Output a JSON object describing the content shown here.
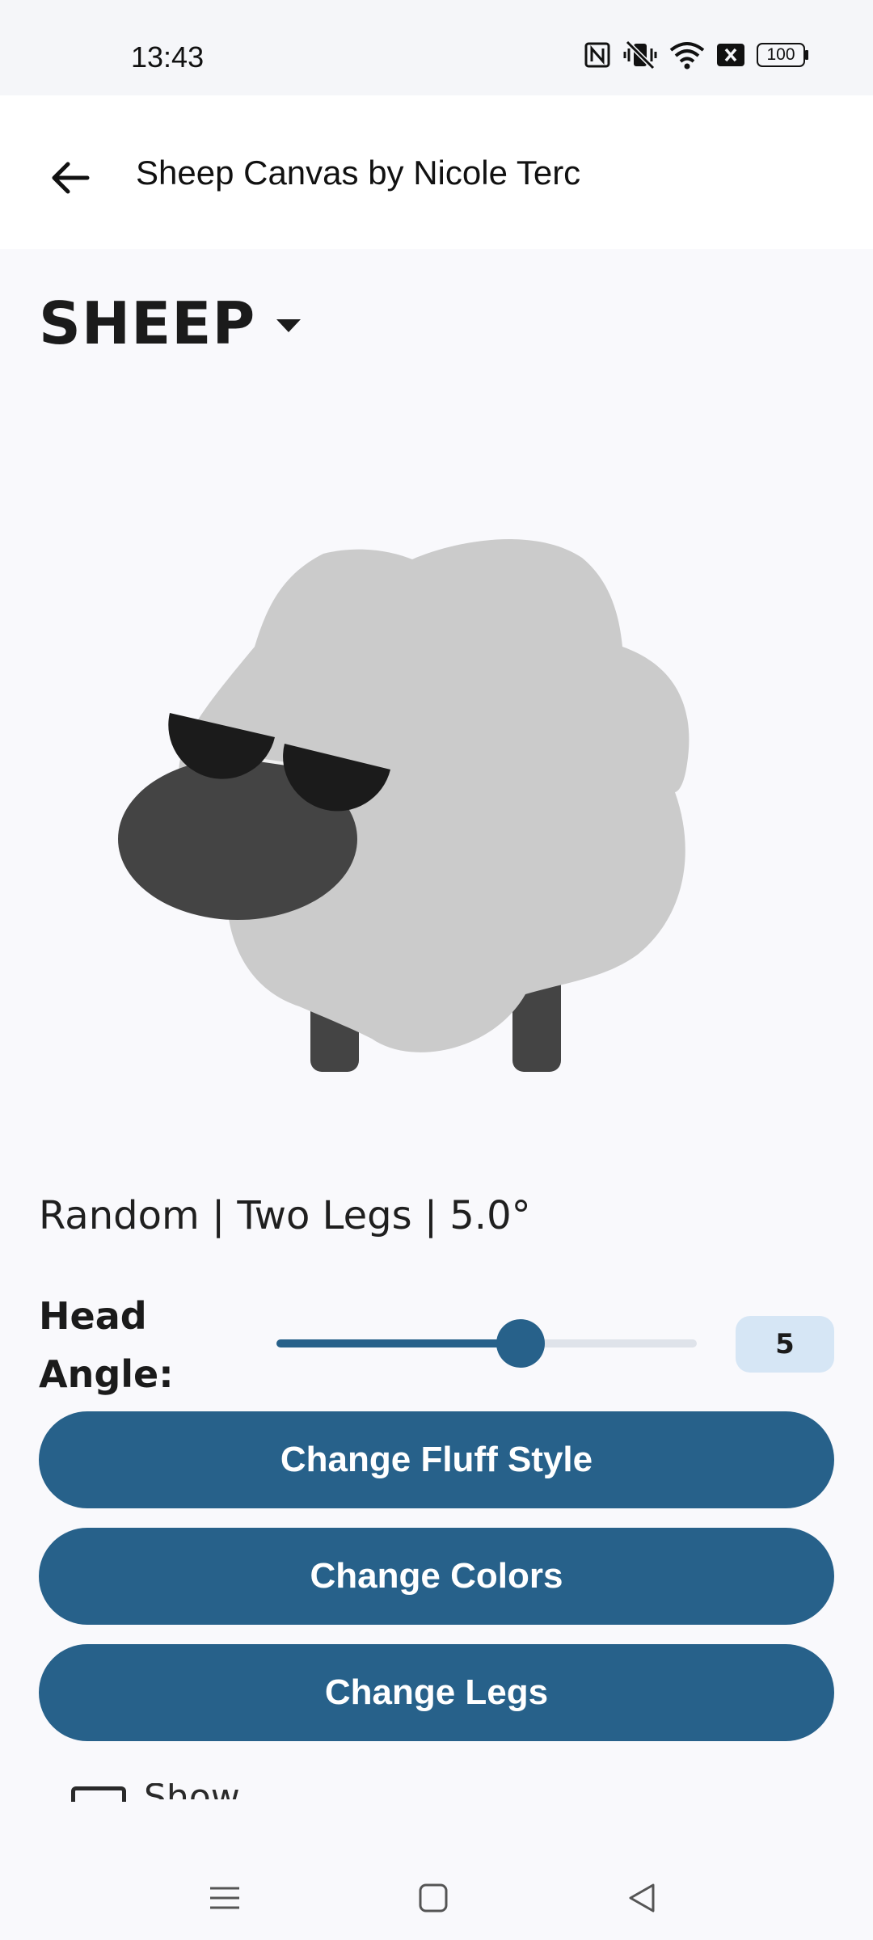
{
  "status_bar": {
    "time": "13:43",
    "battery": "100",
    "icons": [
      "nfc-icon",
      "vibrate-off-icon",
      "wifi-icon",
      "sim-off-icon",
      "battery-icon"
    ]
  },
  "app_bar": {
    "title": "Sheep Canvas by Nicole Terc",
    "back_icon": "arrow-back-icon"
  },
  "selector": {
    "value": "SHEEP",
    "caret_icon": "dropdown-caret-icon"
  },
  "summary": "Random | Two Legs | 5.0°",
  "head_angle": {
    "label": "Head Angle:",
    "value": "5",
    "fraction": 0.58
  },
  "buttons": {
    "fluff": "Change Fluff Style",
    "colors": "Change Colors",
    "legs": "Change Legs"
  },
  "partial_option": {
    "label": "Show guidelines"
  },
  "colors": {
    "primary": "#27618a",
    "value_box": "#d6e6f5",
    "fluff": "#cbcbcb",
    "head": "#444444",
    "glasses": "#1b1b1b"
  },
  "nav_bar": {
    "icons": [
      "menu-icon",
      "home-icon",
      "back-icon"
    ]
  }
}
